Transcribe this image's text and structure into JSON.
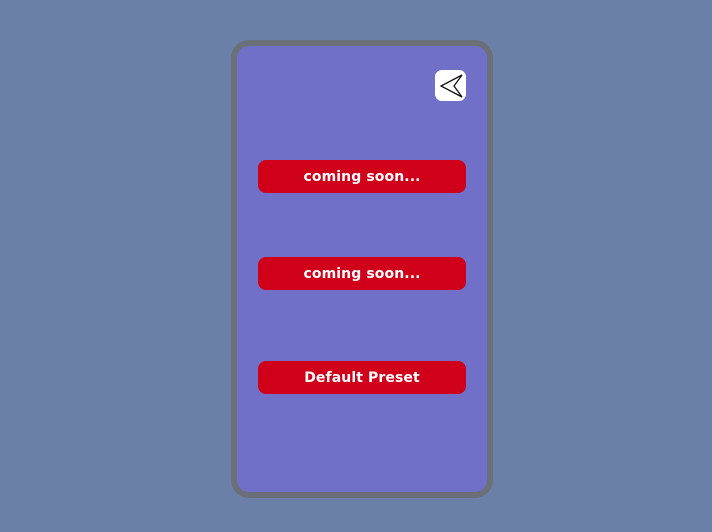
{
  "panel": {
    "back_icon": "back-arrow-icon",
    "buttons": [
      {
        "label": "coming soon..."
      },
      {
        "label": "coming soon..."
      },
      {
        "label": "Default Preset"
      }
    ]
  },
  "colors": {
    "background": "#6b80a8",
    "panel": "#7070c8",
    "panel_border": "#6b6f78",
    "button": "#d0001a",
    "button_text": "#ffffff"
  }
}
